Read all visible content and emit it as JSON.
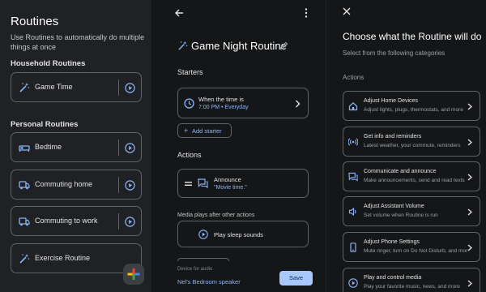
{
  "routines_panel": {
    "title": "Routines",
    "description": "Use Routines to automatically do multiple things at once",
    "household_heading": "Household Routines",
    "household": [
      {
        "label": "Game Time",
        "icon": "magic-wand-icon"
      }
    ],
    "personal_heading": "Personal Routines",
    "personal": [
      {
        "label": "Bedtime",
        "icon": "bed-icon"
      },
      {
        "label": "Commuting home",
        "icon": "vehicle-icon"
      },
      {
        "label": "Commuting to work",
        "icon": "vehicle-icon"
      },
      {
        "label": "Exercise Routine",
        "icon": "magic-wand-icon"
      }
    ],
    "fab_icon": "add-plus-icon"
  },
  "editor_panel": {
    "title": "Game Night Routine",
    "starters_label": "Starters",
    "starter": {
      "title": "When the time is",
      "detail": "7:00 PM • Everyday"
    },
    "add_starter": "Add starter",
    "actions_label": "Actions",
    "action": {
      "title": "Announce",
      "detail": "\"Movie time.\""
    },
    "media_label": "Media plays after other actions",
    "media_action": "Play sleep sounds",
    "device_label": "Device for audio",
    "device": "Nel's Bedroom speaker",
    "save": "Save"
  },
  "category_panel": {
    "title": "Choose what the Routine will do",
    "subtitle": "Select from the following categories",
    "actions_label": "Actions",
    "categories": [
      {
        "title": "Adjust Home Devices",
        "desc": "Adjust lights, plugs, thermostats, and more",
        "icon": "home-icon"
      },
      {
        "title": "Get info and reminders",
        "desc": "Latest weather, your commute, reminders",
        "icon": "broadcast-icon"
      },
      {
        "title": "Communicate and announce",
        "desc": "Make announcements, send and read texts",
        "icon": "chat-icon"
      },
      {
        "title": "Adjust Assistant Volume",
        "desc": "Set volume when Routine is run",
        "icon": "volume-icon"
      },
      {
        "title": "Adjust Phone Settings",
        "desc": "Mute ringer, turn on Do Not Disturb, and more",
        "icon": "phone-icon"
      },
      {
        "title": "Play and control media",
        "desc": "Play your favorite music, news, and more",
        "icon": "play-icon"
      }
    ]
  },
  "colors": {
    "accent": "#8ab4f8",
    "border": "#5f6368",
    "panel_bg": "#1f2125",
    "page_bg": "#151618",
    "save_button": "#a8c7fa"
  }
}
